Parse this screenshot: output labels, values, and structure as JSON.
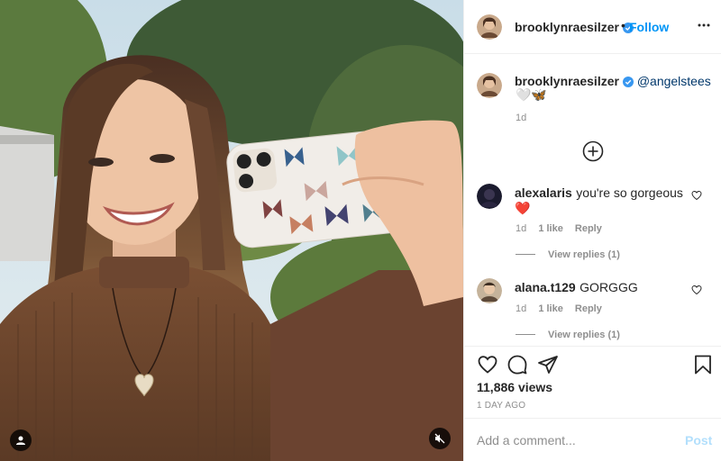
{
  "post": {
    "author": "brooklynraesilzer",
    "follow_label": "Follow",
    "separator": "•",
    "caption": {
      "username": "brooklynraesilzer",
      "mention": "@angelstees",
      "emojis": "🤍🦋",
      "time": "1d"
    },
    "comments": [
      {
        "username": "alexalaris",
        "text": "you're so gorgeous",
        "emoji": "❤️",
        "time": "1d",
        "likes": "1 like",
        "reply_label": "Reply",
        "view_replies": "View replies (1)"
      },
      {
        "username": "alana.t129",
        "text": "GORGGG",
        "time": "1d",
        "likes": "1 like",
        "reply_label": "Reply",
        "view_replies": "View replies (1)"
      }
    ],
    "views": "11,886 views",
    "date": "1 DAY AGO",
    "comment_placeholder": "Add a comment...",
    "post_label": "Post"
  },
  "colors": {
    "accent": "#0095f6",
    "verified": "#3897f0",
    "like_red": "#ed4956",
    "post_disabled": "#b2dffc"
  },
  "icons": {
    "more": "more-options-icon",
    "load_more": "plus-circle-icon",
    "like": "heart-icon",
    "comment": "comment-icon",
    "share": "share-icon",
    "save": "bookmark-icon",
    "tag": "user-tag-icon",
    "mute": "muted-speaker-icon"
  }
}
